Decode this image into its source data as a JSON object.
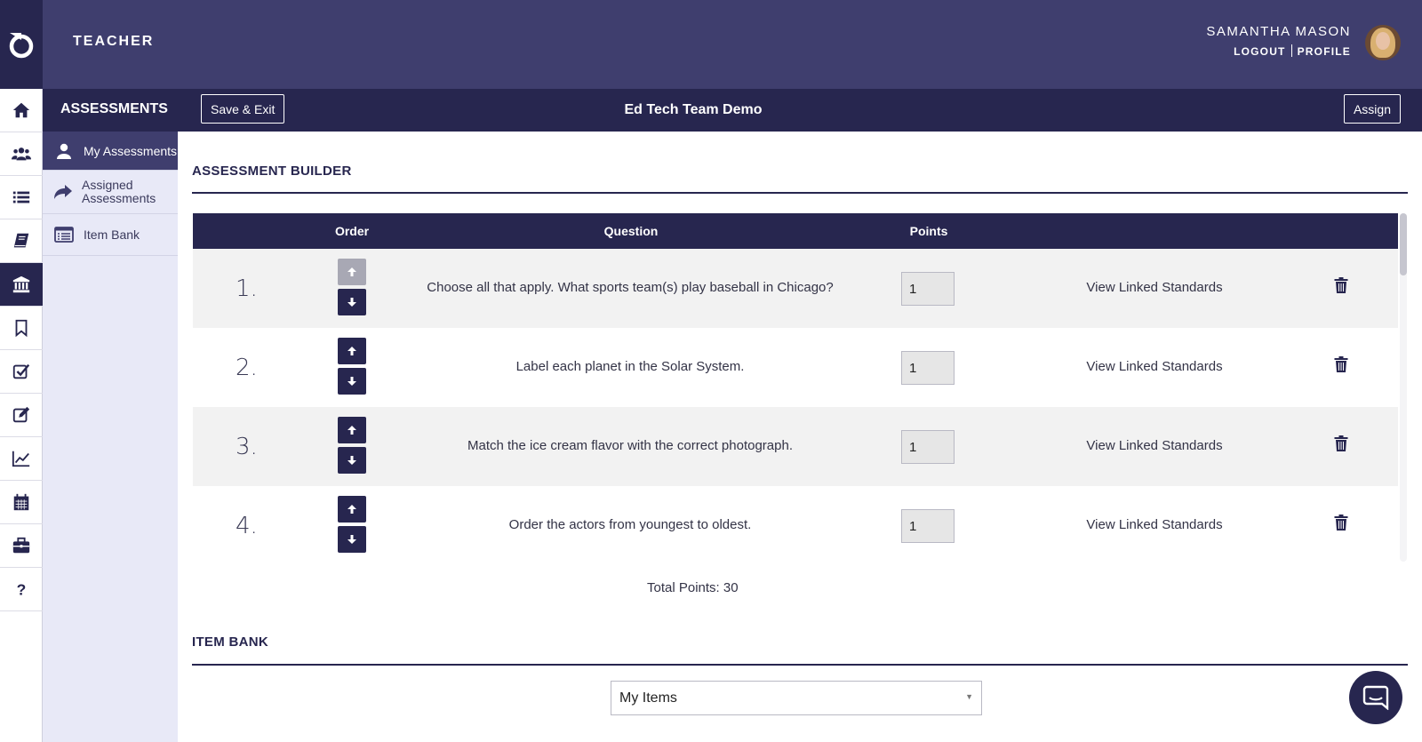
{
  "header": {
    "role": "TEACHER",
    "user_name": "SAMANTHA MASON",
    "logout_label": "LOGOUT",
    "profile_label": "PROFILE"
  },
  "rail": {
    "items": [
      "home-icon",
      "users-icon",
      "list-icon",
      "book-icon",
      "institution-icon",
      "bookmark-icon",
      "checkbox-icon",
      "edit-icon",
      "line-chart-icon",
      "calendar-icon",
      "briefcase-icon",
      "question-icon"
    ],
    "active_index": 4
  },
  "subnav": {
    "heading": "ASSESSMENTS",
    "items": [
      {
        "label": "My Assessments",
        "icon": "user-icon",
        "active": true
      },
      {
        "label": "Assigned Assessments",
        "icon": "share-arrow-icon",
        "active": false
      },
      {
        "label": "Item Bank",
        "icon": "list-card-icon",
        "active": false
      }
    ]
  },
  "titlebar": {
    "save_exit_label": "Save & Exit",
    "title": "Ed Tech Team Demo",
    "assign_label": "Assign"
  },
  "builder": {
    "section_title": "ASSESSMENT BUILDER",
    "columns": {
      "order": "Order",
      "question": "Question",
      "points": "Points"
    },
    "rows": [
      {
        "num": "1.",
        "question": "Choose all that apply.  What sports team(s) play baseball in Chicago?",
        "points": "1",
        "link": "View Linked Standards",
        "up_disabled": true
      },
      {
        "num": "2.",
        "question": "Label each planet in the Solar System.",
        "points": "1",
        "link": "View Linked Standards",
        "up_disabled": false
      },
      {
        "num": "3.",
        "question": "Match the ice cream flavor with the correct photograph.",
        "points": "1",
        "link": "View Linked Standards",
        "up_disabled": false
      },
      {
        "num": "4.",
        "question": "Order the actors from youngest to oldest.",
        "points": "1",
        "link": "View Linked Standards",
        "up_disabled": false
      }
    ],
    "total_points": "Total Points: 30"
  },
  "item_bank": {
    "section_title": "ITEM BANK",
    "selected": "My Items"
  },
  "colors": {
    "header_bg": "#3f3e6e",
    "navy": "#27264f",
    "subnav_bg": "#e8e9f7",
    "row_alt": "#f2f2f2"
  }
}
